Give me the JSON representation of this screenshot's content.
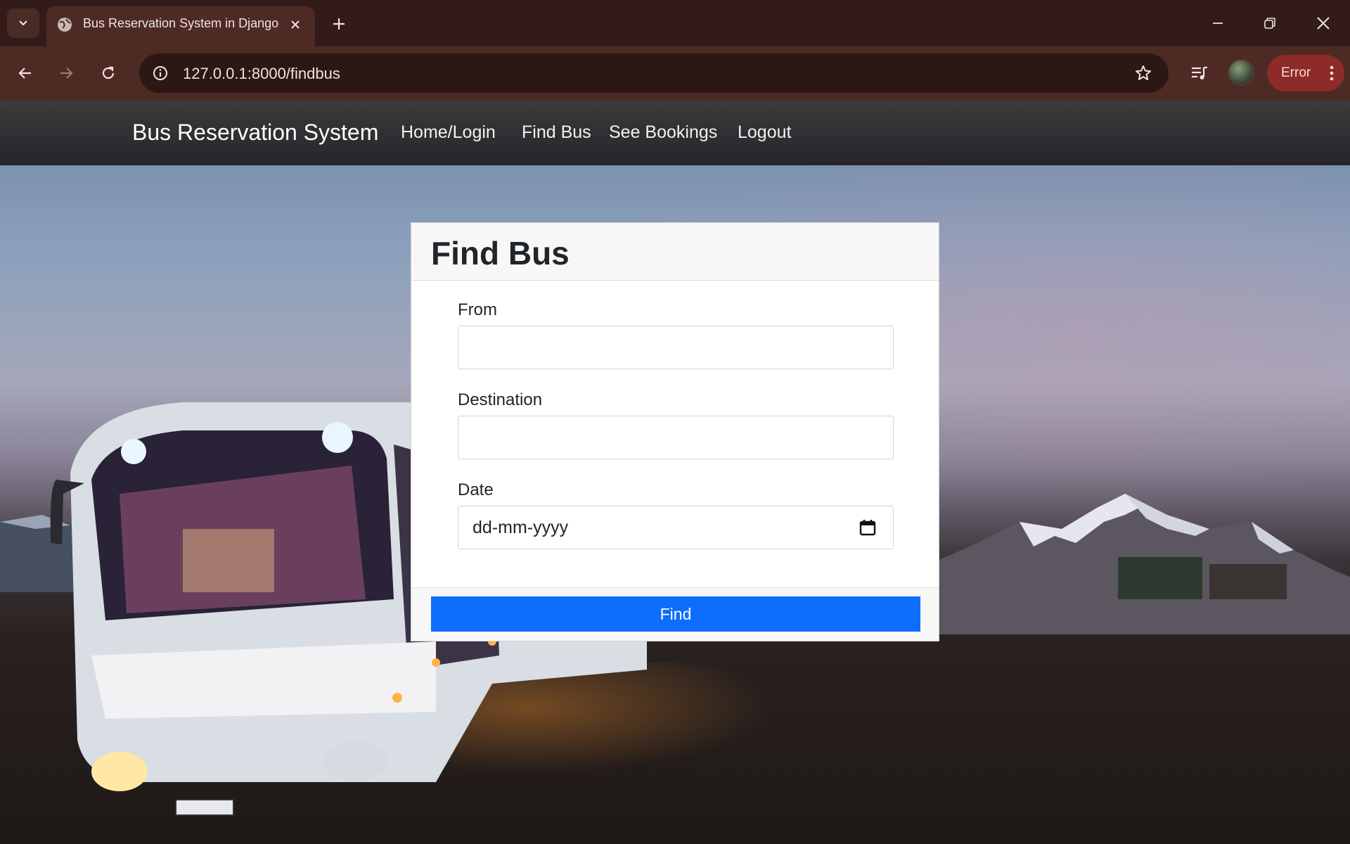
{
  "browser": {
    "tab_title": "Bus Reservation System in Django",
    "url": "127.0.0.1:8000/findbus",
    "error_label": "Error"
  },
  "navbar": {
    "brand": "Bus Reservation System",
    "links": [
      "Home/Login",
      "Find Bus",
      "See Bookings",
      "Logout"
    ]
  },
  "form": {
    "title": "Find Bus",
    "from_label": "From",
    "from_value": "",
    "destination_label": "Destination",
    "destination_value": "",
    "date_label": "Date",
    "date_placeholder": "dd-mm-yyyy",
    "submit_label": "Find"
  },
  "colors": {
    "primary_button": "#0d6efd",
    "navbar": "#2f3033",
    "browser_frame": "#4d2a24"
  }
}
